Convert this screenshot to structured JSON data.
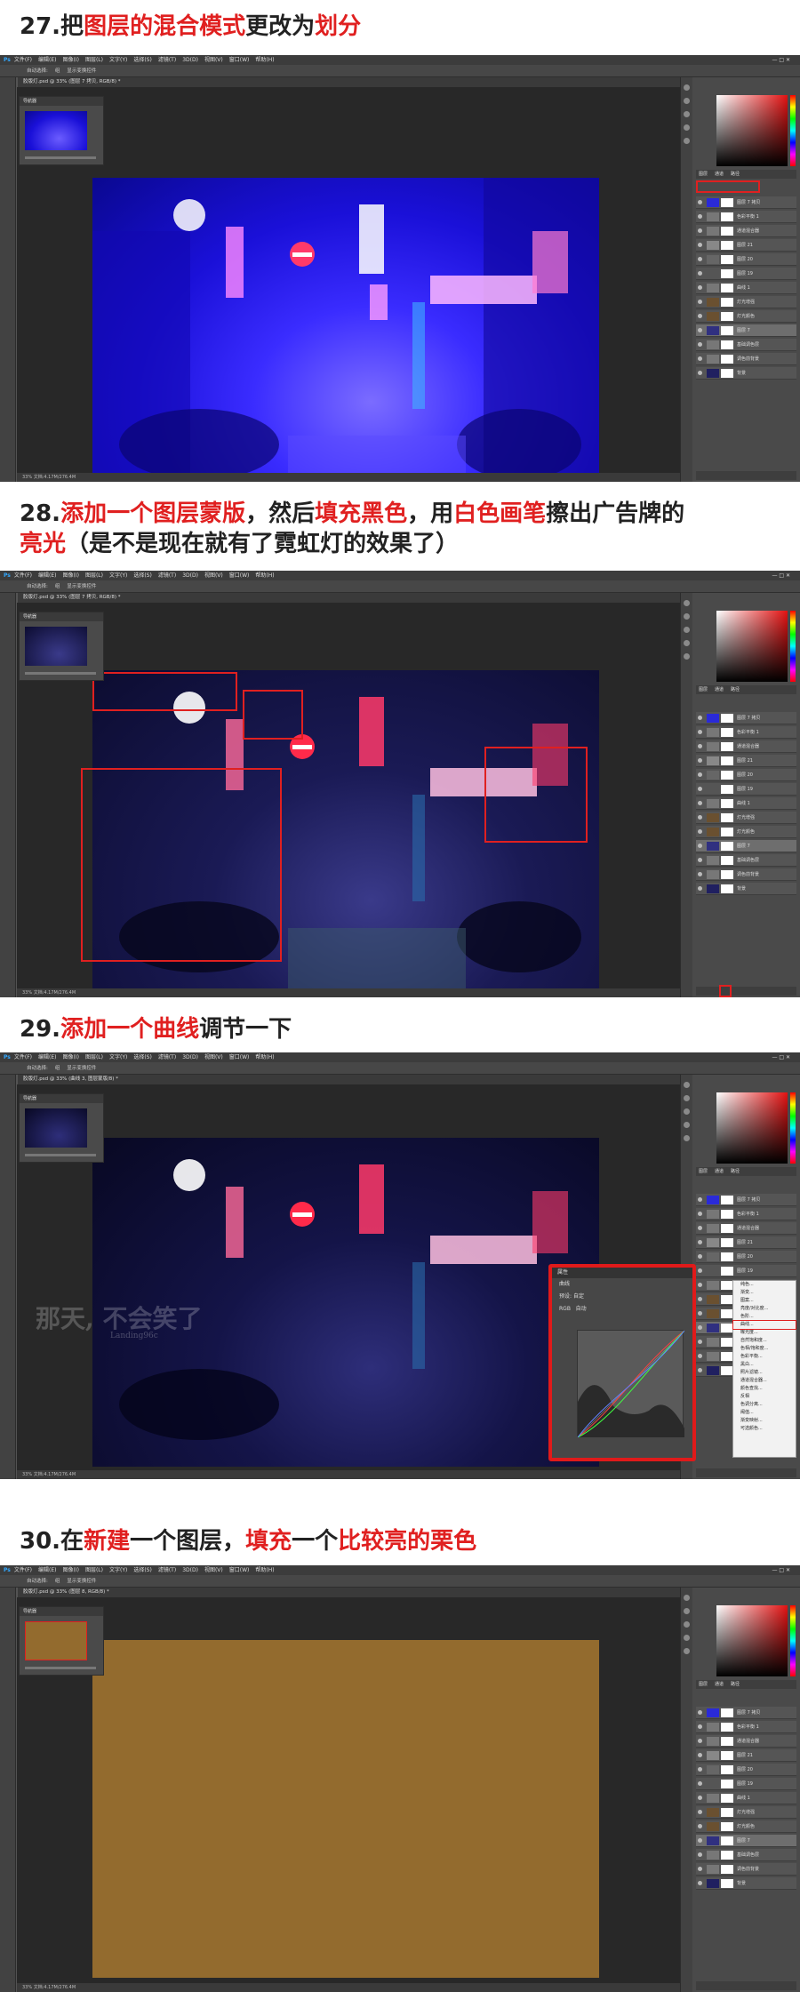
{
  "steps": [
    {
      "title_parts": [
        {
          "text": "27.把",
          "red": false
        },
        {
          "text": "图层的混合模式",
          "red": true
        },
        {
          "text": "更改为",
          "red": false
        },
        {
          "text": "划分",
          "red": true
        }
      ]
    },
    {
      "title_parts": [
        {
          "text": "28.",
          "red": false
        },
        {
          "text": "添加一个图层蒙版",
          "red": true
        },
        {
          "text": "，然后",
          "red": false
        },
        {
          "text": "填充黑色",
          "red": true
        },
        {
          "text": "，用",
          "red": false
        },
        {
          "text": "白色画笔",
          "red": true
        },
        {
          "text": "擦出广告牌的",
          "red": false
        }
      ],
      "title_line2_parts": [
        {
          "text": "亮光",
          "red": true
        },
        {
          "text": "（是不是现在就有了霓虹灯的效果了）",
          "red": false
        }
      ]
    },
    {
      "title_parts": [
        {
          "text": "29.",
          "red": false
        },
        {
          "text": "添加一个曲线",
          "red": true
        },
        {
          "text": "调节一下",
          "red": false
        }
      ]
    },
    {
      "title_parts": [
        {
          "text": "30.在",
          "red": false
        },
        {
          "text": "新建",
          "red": true
        },
        {
          "text": "一个图层，",
          "red": false
        },
        {
          "text": "填充",
          "red": true
        },
        {
          "text": "一个",
          "red": false
        },
        {
          "text": "比较亮的栗色",
          "red": true
        }
      ]
    }
  ],
  "ps": {
    "logo": "Ps",
    "menu": [
      "文件(F)",
      "编辑(E)",
      "图像(I)",
      "图层(L)",
      "文字(Y)",
      "选择(S)",
      "滤镜(T)",
      "3D(D)",
      "视图(V)",
      "窗口(W)",
      "帮助(H)"
    ],
    "window_controls": "— □ ✕",
    "options": [
      "自动选择:",
      "组",
      "显示变换控件"
    ],
    "doc_tab": "胶版灯.psd @ 33% (图层 7 拷贝, RGB/8) *",
    "doc_tab_step29": "胶版灯.psd @ 33% (曲线 3, 图层蒙版/8) *",
    "doc_tab_step30": "胶版灯.psd @ 33% (图层 8, RGB/8) *",
    "navigator_title": "导航器",
    "status": "33%    文档:4.17M/276.4M",
    "panel_tabs": [
      "图层",
      "通道",
      "路径"
    ],
    "layers": [
      "图层 7 拷贝",
      "色彩平衡 1",
      "通道混合器",
      "图层 21",
      "图层 20",
      "图层 19",
      "曲线 1",
      "灯光增强",
      "灯光颜色",
      "图层 7",
      "基础调色层",
      "调色前背景",
      "背景"
    ]
  },
  "curves_panel": {
    "title": "属性",
    "subtitle": "曲线",
    "preset_label": "预设:",
    "preset_value": "自定",
    "channel": "RGB",
    "auto": "自动"
  },
  "context_menu": [
    "纯色...",
    "渐变...",
    "图案...",
    "亮度/对比度...",
    "色阶...",
    "曲线...",
    "曝光度...",
    "自然饱和度...",
    "色相/饱和度...",
    "色彩平衡...",
    "黑白...",
    "照片滤镜...",
    "通道混合器...",
    "颜色查找...",
    "反相",
    "色调分离...",
    "阈值...",
    "渐变映射...",
    "可选颜色..."
  ],
  "watermark": {
    "main": "那天, 不会笑了",
    "sub": "Landing96c"
  },
  "colors": {
    "accent_red": "#e02020",
    "chestnut_fill": "#936b2e",
    "ps_bg": "#535353"
  }
}
